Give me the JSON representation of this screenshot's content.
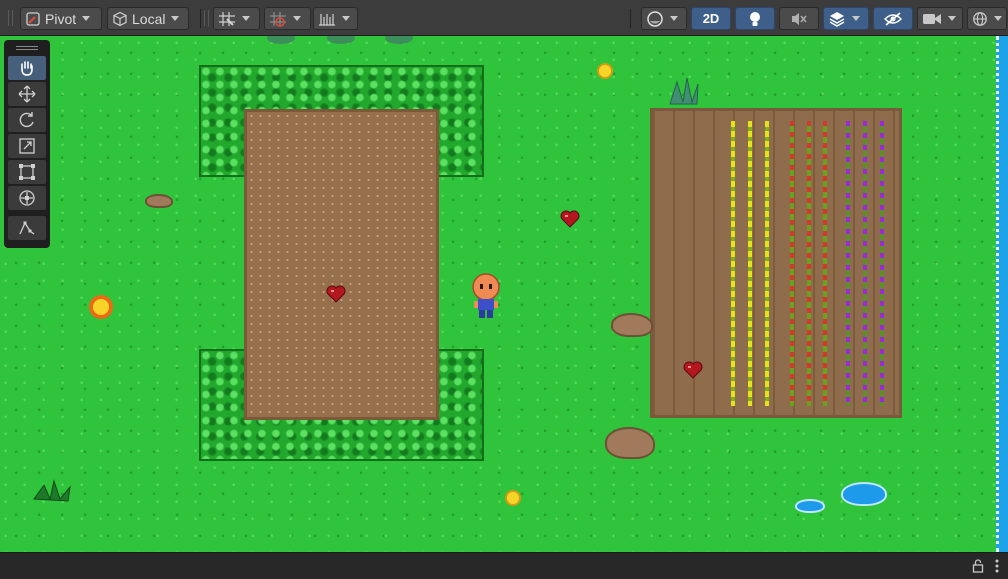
{
  "toolbar": {
    "pivot_label": "Pivot",
    "local_label": "Local",
    "mode_2d_label": "2D",
    "colors": {
      "active": "#3e5f8a",
      "button": "#4b4b4b",
      "bar": "#3c3c3c"
    },
    "icons": [
      "pivot-icon",
      "local-cube-icon",
      "grid-snap-icon",
      "increment-snap-icon",
      "ruler-grid-icon",
      "shading-sphere-icon",
      "lighting-icon",
      "audio-mute-icon",
      "effects-layers-icon",
      "hidden-eye-icon",
      "camera-icon",
      "gizmos-icon"
    ]
  },
  "tools": {
    "items": [
      "hand-tool",
      "move-tool",
      "rotate-tool",
      "scale-tool",
      "rect-tool",
      "transform-tool",
      "custom-editor-tool"
    ],
    "active": "hand-tool"
  },
  "scene": {
    "colors": {
      "grass": "#2fc43b",
      "dirt": "#96704c",
      "hedge": "#21a82d",
      "water": "#1fa3e8"
    }
  },
  "statusbar": {
    "icons": [
      "lock-icon",
      "more-vertical-icon"
    ]
  }
}
